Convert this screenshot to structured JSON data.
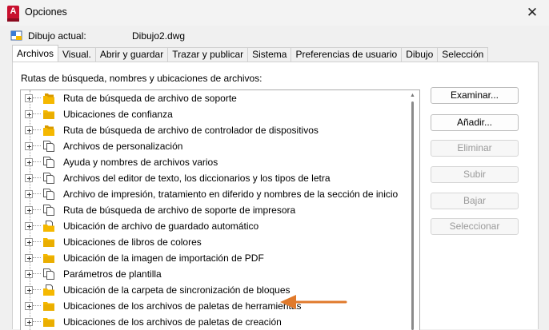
{
  "window": {
    "title": "Opciones",
    "app_icon_letter": "A",
    "close_glyph": "✕"
  },
  "current_drawing": {
    "label": "Dibujo actual:",
    "value": "Dibujo2.dwg"
  },
  "tabs": [
    {
      "label": "Archivos",
      "active": true
    },
    {
      "label": "Visual."
    },
    {
      "label": "Abrir y guardar"
    },
    {
      "label": "Trazar y publicar"
    },
    {
      "label": "Sistema"
    },
    {
      "label": "Preferencias de usuario"
    },
    {
      "label": "Dibujo"
    },
    {
      "label": "Selección"
    }
  ],
  "panel": {
    "section_label": "Rutas de búsqueda, nombres y ubicaciones de archivos:"
  },
  "tree_items": [
    {
      "label": "Ruta de búsqueda de archivo de soporte",
      "icon": "folder-stack-icon"
    },
    {
      "label": "Ubicaciones de confianza",
      "icon": "folder-icon"
    },
    {
      "label": "Ruta de búsqueda de archivo de controlador de dispositivos",
      "icon": "folder-stack-icon"
    },
    {
      "label": "Archivos de personalización",
      "icon": "documents-icon"
    },
    {
      "label": "Ayuda y nombres de archivos varios",
      "icon": "documents-icon"
    },
    {
      "label": "Archivos del editor de texto, los diccionarios y los tipos de letra",
      "icon": "documents-icon"
    },
    {
      "label": "Archivo de impresión, tratamiento en diferido y nombres de la sección de inicio",
      "icon": "documents-icon"
    },
    {
      "label": "Ruta de búsqueda de archivo de soporte de impresora",
      "icon": "documents-icon"
    },
    {
      "label": "Ubicación de archivo de guardado automático",
      "icon": "folder-doc-icon"
    },
    {
      "label": "Ubicaciones de libros de colores",
      "icon": "folder-icon"
    },
    {
      "label": "Ubicación de la imagen de importación de PDF",
      "icon": "folder-icon"
    },
    {
      "label": "Parámetros de plantilla",
      "icon": "documents-icon"
    },
    {
      "label": "Ubicación de la carpeta de sincronización de bloques",
      "icon": "folder-doc-icon"
    },
    {
      "label": "Ubicaciones de los archivos de paletas de herramientas",
      "icon": "folder-icon"
    },
    {
      "label": "Ubicaciones de los archivos de paletas de creación",
      "icon": "folder-icon"
    }
  ],
  "buttons": [
    {
      "label": "Examinar...",
      "enabled": true
    },
    {
      "label": "Añadir...",
      "enabled": true
    },
    {
      "label": "Eliminar",
      "enabled": false
    },
    {
      "label": "Subir",
      "enabled": false
    },
    {
      "label": "Bajar",
      "enabled": false
    },
    {
      "label": "Seleccionar",
      "enabled": false
    }
  ],
  "colors": {
    "folder": "#f5b800",
    "folder_dark": "#d89a00",
    "annotation_arrow": "#e07a2c",
    "app_icon": "#c8102e"
  }
}
